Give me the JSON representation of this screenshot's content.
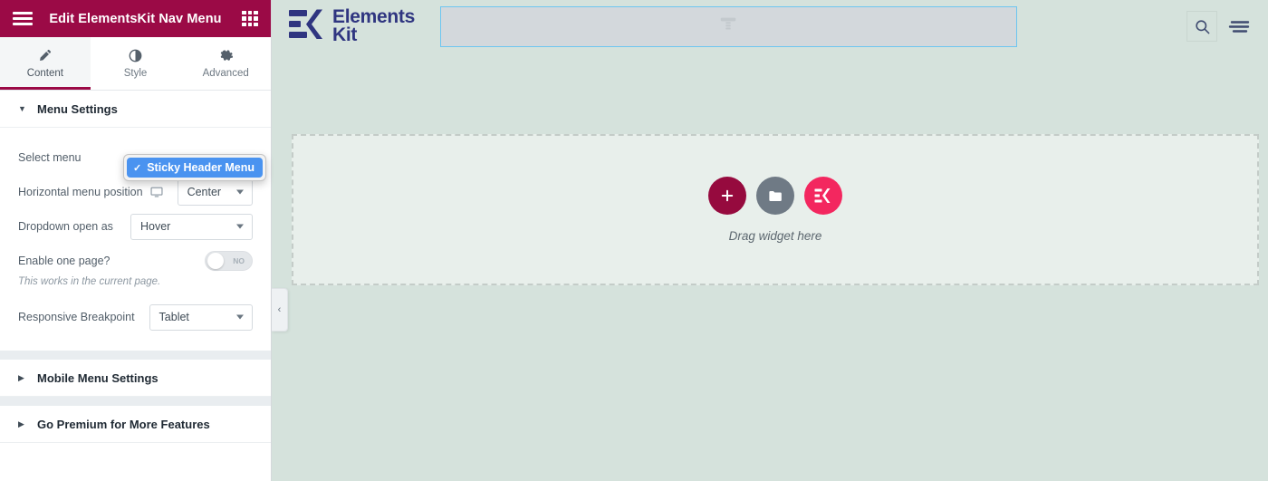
{
  "panel": {
    "header": {
      "title": "Edit ElementsKit Nav Menu",
      "menu_icon": "hamburger-icon",
      "apps_icon": "grid-icon"
    },
    "tabs": [
      {
        "label": "Content",
        "icon": "pencil-icon",
        "active": true
      },
      {
        "label": "Style",
        "icon": "contrast-icon",
        "active": false
      },
      {
        "label": "Advanced",
        "icon": "gear-icon",
        "active": false
      }
    ],
    "sections": [
      {
        "label": "Menu Settings",
        "expanded": true
      },
      {
        "label": "Mobile Menu Settings",
        "expanded": false
      },
      {
        "label": "Go Premium for More Features",
        "expanded": false
      }
    ],
    "menu_settings": {
      "select_menu": {
        "label": "Select menu",
        "value": "Sticky Header Menu",
        "dropdown_open": true,
        "checkmark": "✓",
        "highlight_color": "#4a93f0"
      },
      "horizontal_position": {
        "label": "Horizontal menu position",
        "device_icon": "desktop-monitor-icon",
        "value": "Center"
      },
      "dropdown_open_as": {
        "label": "Dropdown open as",
        "value": "Hover"
      },
      "one_page": {
        "label": "Enable one page?",
        "toggle_state": "NO",
        "hint": "This works in the current page."
      },
      "responsive_breakpoint": {
        "label": "Responsive Breakpoint",
        "value": "Tablet"
      }
    },
    "collapse_handle": "‹"
  },
  "canvas": {
    "logo": {
      "line1": "Elements",
      "line2": "Kit",
      "icon": "elementskit-logo-icon",
      "color": "#2f3580"
    },
    "nav_placeholder": {
      "icon": "nav-menu-widget-icon"
    },
    "header_actions": [
      {
        "icon": "search-icon"
      },
      {
        "icon": "hamburger-menu-icon"
      }
    ],
    "dropzone": {
      "text": "Drag widget here",
      "buttons": [
        {
          "icon": "plus-icon",
          "name": "add-section-button",
          "color": "#960a3e"
        },
        {
          "icon": "folder-icon",
          "name": "template-library-button",
          "color": "#6f7a85"
        },
        {
          "icon": "ek-logo-icon",
          "name": "elementskit-widgets-button",
          "color": "#f3275f"
        }
      ]
    }
  }
}
